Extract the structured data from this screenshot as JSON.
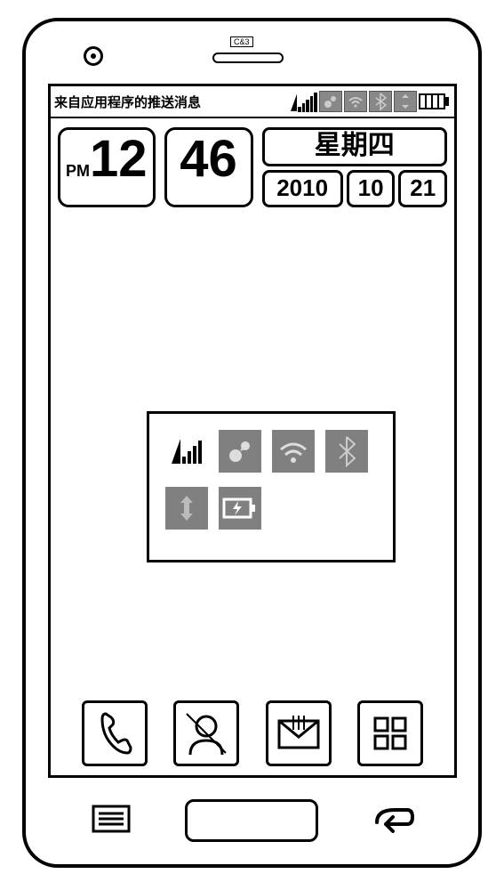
{
  "status_bar": {
    "push_message": "来自应用程序的推送消息",
    "signal_level": 5,
    "icons": [
      "gps-icon",
      "wifi-icon",
      "bluetooth-icon",
      "sync-icon"
    ]
  },
  "clock": {
    "ampm": "PM",
    "hour": "12",
    "minute": "46",
    "weekday": "星期四",
    "year": "2010",
    "month": "10",
    "day": "21"
  },
  "toggle_panel": {
    "row1": [
      {
        "name": "signal-toggle",
        "type": "signal"
      },
      {
        "name": "gps-toggle",
        "type": "gps"
      },
      {
        "name": "wifi-toggle",
        "type": "wifi"
      },
      {
        "name": "bluetooth-toggle",
        "type": "bluetooth"
      }
    ],
    "row2": [
      {
        "name": "sync-toggle",
        "type": "sync"
      },
      {
        "name": "battery-toggle",
        "type": "battery"
      }
    ]
  },
  "dock": [
    {
      "name": "phone-app",
      "icon": "phone-icon"
    },
    {
      "name": "contacts-app",
      "icon": "contact-icon"
    },
    {
      "name": "messages-app",
      "icon": "message-icon"
    },
    {
      "name": "apps-drawer",
      "icon": "grid-icon"
    }
  ]
}
